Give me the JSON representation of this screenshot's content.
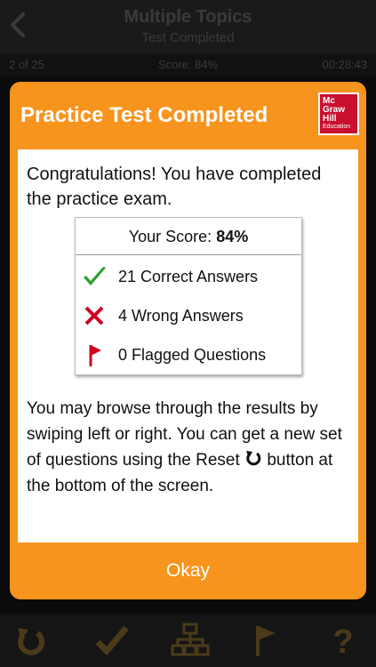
{
  "header": {
    "title": "Multiple Topics",
    "subtitle": "Test Completed"
  },
  "status": {
    "progress": "2 of 25",
    "score": "Score: 84%",
    "timer": "00:28:43"
  },
  "modal": {
    "title": "Practice Test Completed",
    "logo": {
      "line1": "Mc",
      "line2": "Graw",
      "line3": "Hill",
      "line4": "Education"
    },
    "intro": "Congratulations! You have completed the practice exam.",
    "score": {
      "label": "Your Score:",
      "value": "84%"
    },
    "results": [
      {
        "icon": "check-icon",
        "text": "21 Correct Answers"
      },
      {
        "icon": "x-icon",
        "text": "4 Wrong Answers"
      },
      {
        "icon": "flag-icon",
        "text": "0 Flagged Questions"
      }
    ],
    "help_before": "You may browse through the results by swiping left or right. You can get a new set of questions using the Reset",
    "help_after": " button at the bottom of the screen.",
    "okay_label": "Okay"
  },
  "bottom_bar": [
    "reset-icon",
    "check-icon",
    "sitemap-icon",
    "flag-icon",
    "help-icon"
  ],
  "colors": {
    "accent": "#f7941d",
    "brand_red": "#c8102e",
    "check_green": "#2ca02c",
    "wrong_red": "#d0021b"
  }
}
